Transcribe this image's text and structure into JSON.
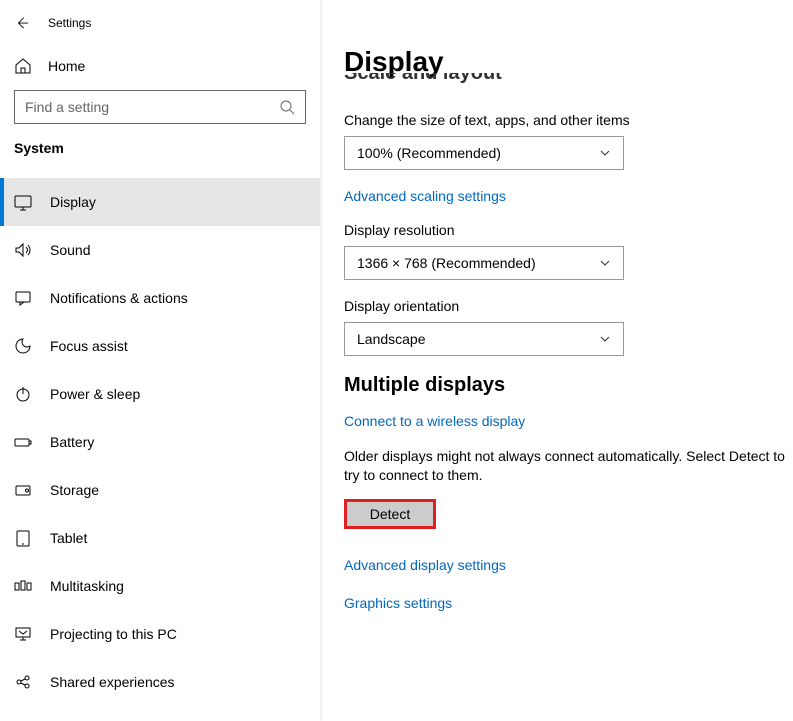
{
  "header": {
    "app_title": "Settings"
  },
  "sidebar": {
    "home_label": "Home",
    "search_placeholder": "Find a setting",
    "category": "System",
    "items": [
      {
        "label": "Display",
        "active": true
      },
      {
        "label": "Sound",
        "active": false
      },
      {
        "label": "Notifications & actions",
        "active": false
      },
      {
        "label": "Focus assist",
        "active": false
      },
      {
        "label": "Power & sleep",
        "active": false
      },
      {
        "label": "Battery",
        "active": false
      },
      {
        "label": "Storage",
        "active": false
      },
      {
        "label": "Tablet",
        "active": false
      },
      {
        "label": "Multitasking",
        "active": false
      },
      {
        "label": "Projecting to this PC",
        "active": false
      },
      {
        "label": "Shared experiences",
        "active": false
      }
    ]
  },
  "main": {
    "title": "Display",
    "scale": {
      "section_truncated": "Scale and layout",
      "size_label": "Change the size of text, apps, and other items",
      "size_value": "100% (Recommended)",
      "advanced_scaling_link": "Advanced scaling settings",
      "resolution_label": "Display resolution",
      "resolution_value": "1366 × 768 (Recommended)",
      "orientation_label": "Display orientation",
      "orientation_value": "Landscape"
    },
    "multi": {
      "heading": "Multiple displays",
      "connect_link": "Connect to a wireless display",
      "older_text": "Older displays might not always connect automatically. Select Detect to try to connect to them.",
      "detect_button": "Detect",
      "advanced_link": "Advanced display settings",
      "graphics_link": "Graphics settings"
    }
  }
}
